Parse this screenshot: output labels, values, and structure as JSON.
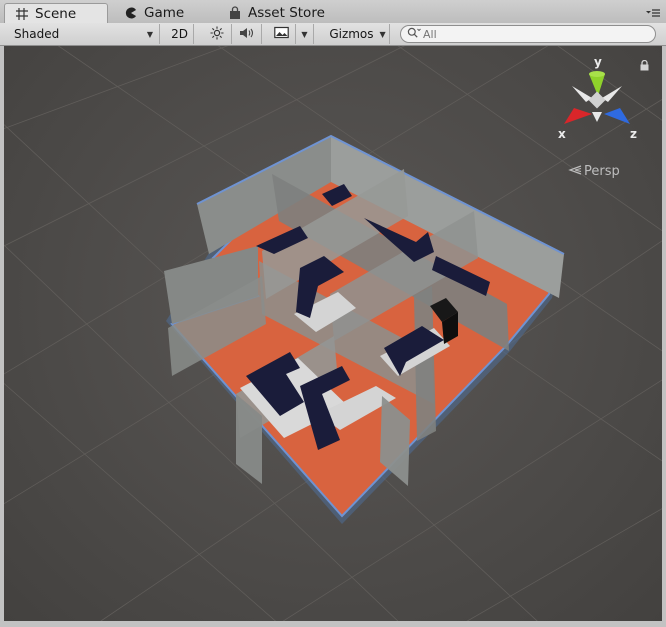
{
  "tabs": [
    {
      "label": "Scene",
      "icon": "grid-icon",
      "active": true
    },
    {
      "label": "Game",
      "icon": "pacman-icon",
      "active": false
    },
    {
      "label": "Asset Store",
      "icon": "store-bag-icon",
      "active": false
    }
  ],
  "toolbar": {
    "draw_mode": "Shaded",
    "mode_2d": "2D",
    "gizmos_label": "Gizmos",
    "search_placeholder": "All"
  },
  "viewport": {
    "projection_label": "Persp",
    "axis_labels": {
      "x": "x",
      "y": "y",
      "z": "z"
    },
    "colors": {
      "background": "#4a4846",
      "floor": "#d8633f",
      "walls": "#8a8d8b",
      "arrows": "#1a1c3a",
      "outline": "#5f86c7",
      "axis_x": "#d9262a",
      "axis_y": "#8fd12b",
      "axis_z": "#2f6ae0"
    }
  }
}
